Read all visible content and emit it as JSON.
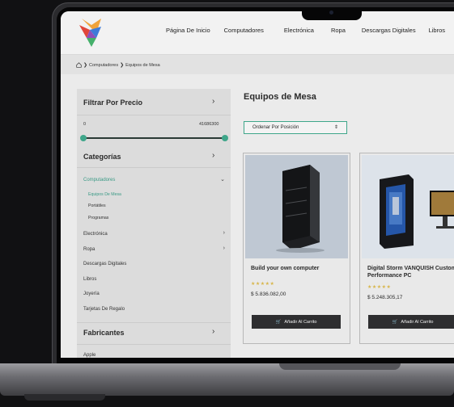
{
  "header": {
    "nav": [
      "Página De Inicio",
      "Computadores",
      "Electrónica",
      "Ropa",
      "Descargas Digitales",
      "Libros"
    ]
  },
  "breadcrumb": {
    "items": [
      "Computadores",
      "Equipos de Mesa"
    ]
  },
  "sidebar": {
    "price_filter": {
      "title": "Filtrar Por Precio",
      "min": "0",
      "max": "41686300",
      "range_low_fraction": 0,
      "range_high_fraction": 1
    },
    "categories_title": "Categorías",
    "categories": [
      {
        "label": "Computadores",
        "active": true
      },
      {
        "label": "Electrónica"
      },
      {
        "label": "Ropa"
      },
      {
        "label": "Descargas Digitales"
      },
      {
        "label": "Libros"
      },
      {
        "label": "Joyería"
      },
      {
        "label": "Tarjetas De Regalo"
      }
    ],
    "subcategories": [
      "Equipos De Mesa",
      "Portátiles",
      "Programas"
    ],
    "manufacturers_title": "Fabricantes",
    "manufacturers": [
      "Apple"
    ]
  },
  "main": {
    "title": "Equipos de Mesa",
    "sort_label": "Ordenar Por Posición",
    "sort_arrow": "⇕",
    "products": [
      {
        "name": "Build your own computer",
        "stars": "★★★★★",
        "rating": 5,
        "price": "$ 5.836.082,00",
        "button": "Añadir Al Carrito"
      },
      {
        "name": "Digital Storm VANQUISH Custom Performance PC",
        "stars": "★★★★★",
        "rating": 5,
        "price": "$ 5.248.305,17",
        "button": "Añadir Al Carrito"
      }
    ]
  },
  "colors": {
    "accent": "#3fa68a",
    "button": "#2e2e30",
    "star": "#d8b64c"
  }
}
